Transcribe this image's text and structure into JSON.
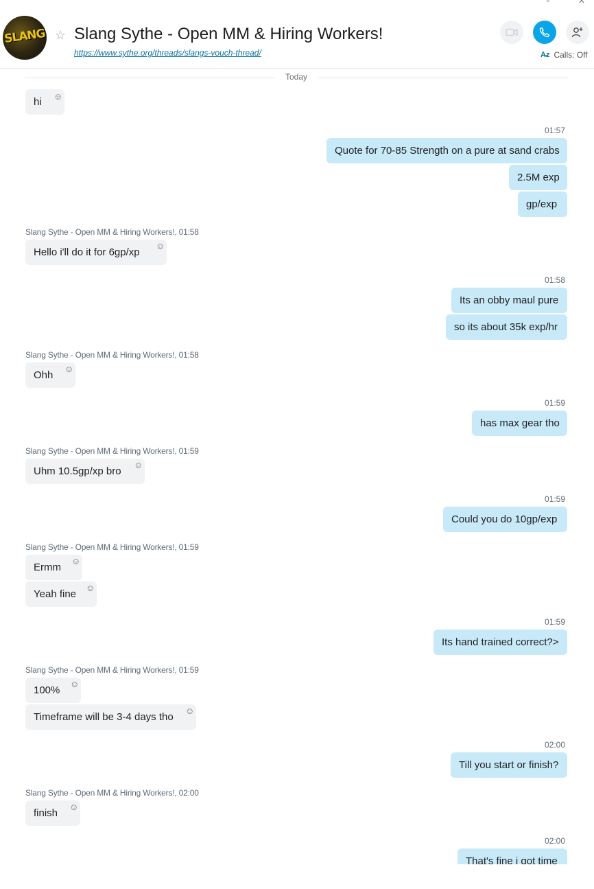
{
  "header": {
    "avatar_text": "SLANG",
    "title": "Slang Sythe - Open MM & Hiring Workers!",
    "link": "https://www.sythe.org/threads/slangs-vouch-thread/",
    "calls_label": "Calls: Off",
    "icons": [
      "star-icon",
      "video-icon",
      "phone-icon",
      "add-person-icon",
      "translate-icon"
    ]
  },
  "divider_label": "Today",
  "sender": "Slang Sythe - Open MM & Hiring Workers!",
  "messages": [
    {
      "text": "hi"
    },
    {
      "time": "01:57"
    },
    {
      "text": "Quote for 70-85 Strength on a pure at sand crabs"
    },
    {
      "text": "2.5M exp"
    },
    {
      "text": "gp/exp"
    },
    {
      "meta": "Slang Sythe - Open MM & Hiring Workers!, 01:58"
    },
    {
      "text": "Hello i'll do it for 6gp/xp"
    },
    {
      "time": "01:58"
    },
    {
      "text": "Its an obby maul pure"
    },
    {
      "text": "so its about 35k exp/hr"
    },
    {
      "meta": "Slang Sythe - Open MM & Hiring Workers!, 01:58"
    },
    {
      "text": "Ohh"
    },
    {
      "time": "01:59"
    },
    {
      "text": "has max gear tho"
    },
    {
      "meta": "Slang Sythe - Open MM & Hiring Workers!, 01:59"
    },
    {
      "text": "Uhm 10.5gp/xp bro"
    },
    {
      "time": "01:59"
    },
    {
      "text": "Could you do 10gp/exp"
    },
    {
      "meta": "Slang Sythe - Open MM & Hiring Workers!, 01:59"
    },
    {
      "text": "Ermm"
    },
    {
      "text": "Yeah fine"
    },
    {
      "time": "01:59"
    },
    {
      "text": "Its hand trained correct?>"
    },
    {
      "meta": "Slang Sythe - Open MM & Hiring Workers!, 01:59"
    },
    {
      "text": "100%"
    },
    {
      "text": "Timeframe will be 3-4 days tho"
    },
    {
      "time": "02:00"
    },
    {
      "text": "Till you start or finish?"
    },
    {
      "meta": "Slang Sythe - Open MM & Hiring Workers!, 02:00"
    },
    {
      "text": "finish"
    },
    {
      "time": "02:00"
    },
    {
      "text": "That's fine i got time"
    }
  ],
  "colors": {
    "incoming_bubble": "#f1f2f4",
    "outgoing_bubble": "#c7e9f8",
    "call_button": "#0aa5e6",
    "link": "#0a6fa3"
  }
}
